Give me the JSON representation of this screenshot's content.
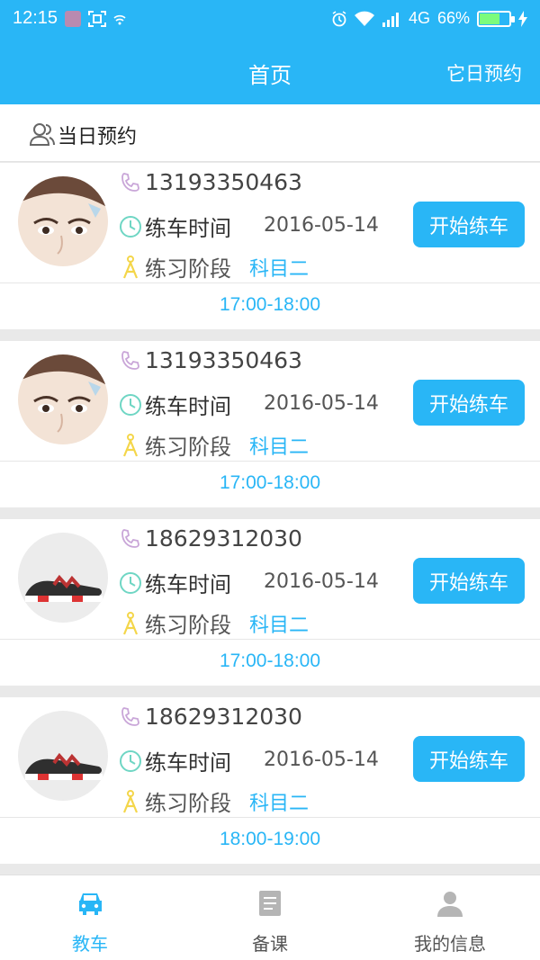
{
  "status_bar": {
    "time": "12:15",
    "network": "4G",
    "battery": "66%",
    "battery_level": 0.66,
    "icons": [
      "app-icon",
      "screenshot-icon",
      "wifi-small-icon",
      "alarm-icon",
      "wifi-icon",
      "signal-icon",
      "battery-icon",
      "charging-icon"
    ]
  },
  "header": {
    "title": "首页",
    "action": "它日预约"
  },
  "section": {
    "icon": "users-icon",
    "title": "当日预约"
  },
  "appointments": [
    {
      "phone": "13193350463",
      "time_label": "练车时间",
      "date": "2016-05-14",
      "stage_label": "练习阶段",
      "subject": "科目二",
      "button": "开始练车",
      "slot": "17:00-18:00",
      "avatar": "woman-face"
    },
    {
      "phone": "13193350463",
      "time_label": "练车时间",
      "date": "2016-05-14",
      "stage_label": "练习阶段",
      "subject": "科目二",
      "button": "开始练车",
      "slot": "17:00-18:00",
      "avatar": "woman-face"
    },
    {
      "phone": "18629312030",
      "time_label": "练车时间",
      "date": "2016-05-14",
      "stage_label": "练习阶段",
      "subject": "科目二",
      "button": "开始练车",
      "slot": "17:00-18:00",
      "avatar": "sneaker"
    },
    {
      "phone": "18629312030",
      "time_label": "练车时间",
      "date": "2016-05-14",
      "stage_label": "练习阶段",
      "subject": "科目二",
      "button": "开始练车",
      "slot": "18:00-19:00",
      "avatar": "sneaker"
    }
  ],
  "bottom_nav": [
    {
      "label": "教车",
      "icon": "car-icon",
      "active": true
    },
    {
      "label": "备课",
      "icon": "document-icon",
      "active": false
    },
    {
      "label": "我的信息",
      "icon": "person-icon",
      "active": false
    }
  ],
  "colors": {
    "primary": "#29b6f6",
    "phone_icon": "#c9a6d8",
    "clock_icon": "#6fd6c4",
    "stage_icon": "#f4d64a"
  }
}
